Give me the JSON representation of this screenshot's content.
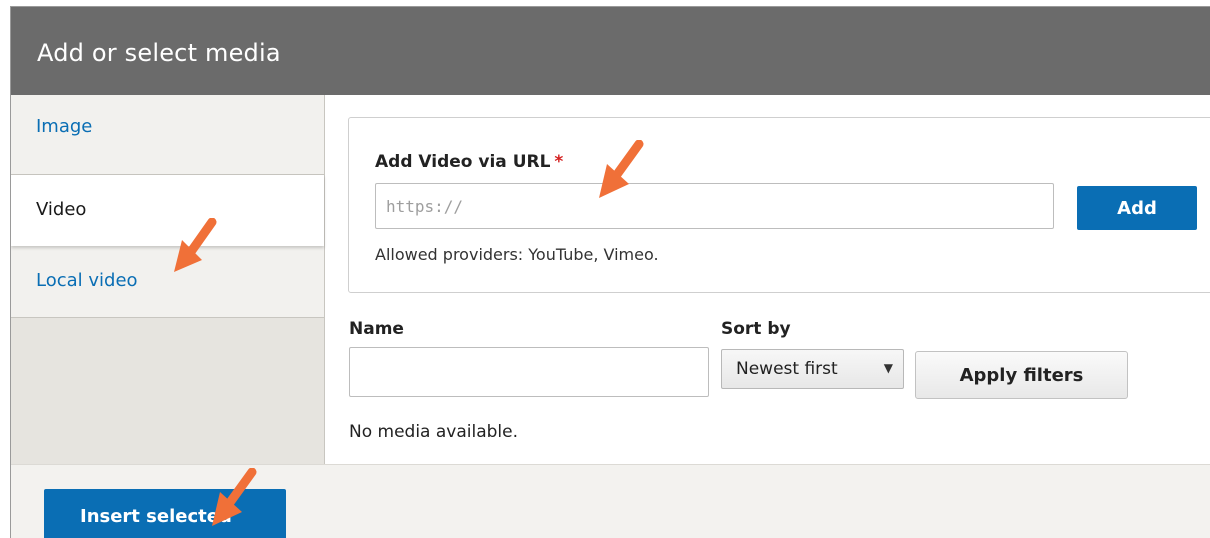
{
  "dialog": {
    "title": "Add or select media"
  },
  "sidebar": {
    "items": [
      {
        "label": "Image",
        "active": false
      },
      {
        "label": "Video",
        "active": true
      },
      {
        "label": "Local video",
        "active": false
      }
    ]
  },
  "url_form": {
    "label": "Add Video via URL",
    "required_mark": "*",
    "input_placeholder": "https://",
    "input_value": "",
    "add_label": "Add",
    "help_text": "Allowed providers: YouTube, Vimeo."
  },
  "filters": {
    "name_label": "Name",
    "name_value": "",
    "sort_label": "Sort by",
    "sort_selected": "Newest first",
    "apply_label": "Apply filters"
  },
  "results": {
    "empty_message": "No media available."
  },
  "footer": {
    "insert_label": "Insert selected"
  },
  "colors": {
    "titlebar": "#6b6b6b",
    "primary_button": "#0a6eb4",
    "link": "#0a6eb4",
    "required": "#d42020",
    "annotation_arrow": "#f07038"
  },
  "icons": {
    "sort_caret": "caret-down-icon",
    "annotation": "arrow-annotation-icon"
  }
}
